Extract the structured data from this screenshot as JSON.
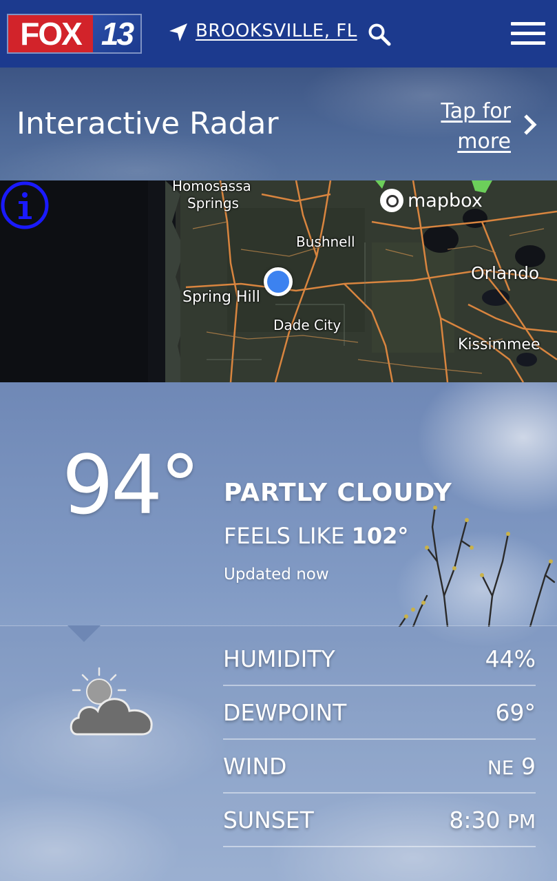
{
  "header": {
    "logo_left": "FOX",
    "logo_right": "13",
    "location": "BROOKSVILLE, FL"
  },
  "banner": {
    "title": "Interactive Radar",
    "link_line1": "Tap for",
    "link_line2": "more"
  },
  "map": {
    "attribution": "mapbox",
    "places": {
      "homosassa_line1": "Homosassa",
      "homosassa_line2": "Springs",
      "bushnell": "Bushnell",
      "orlando": "Orlando",
      "spring_hill": "Spring Hill",
      "dade_city": "Dade City",
      "kissimmee": "Kissimmee"
    }
  },
  "current": {
    "temperature": "94°",
    "condition": "PARTLY CLOUDY",
    "feels_like_label": "FEELS LIKE",
    "feels_like_value": "102°",
    "updated": "Updated now"
  },
  "details": [
    {
      "label": "HUMIDITY",
      "value": "44%",
      "prefix": "",
      "suffix": ""
    },
    {
      "label": "DEWPOINT",
      "value": "69°",
      "prefix": "",
      "suffix": ""
    },
    {
      "label": "WIND",
      "value": "9",
      "prefix": "NE",
      "suffix": ""
    },
    {
      "label": "SUNSET",
      "value": "8:30",
      "prefix": "",
      "suffix": "PM"
    }
  ],
  "colors": {
    "header_bg": "#1c3a8e",
    "logo_red": "#d2232a",
    "location_dot": "#3c82f0",
    "info_icon": "#1a1aff"
  },
  "icons": {
    "location": "location-arrow-icon",
    "search": "search-icon",
    "menu": "hamburger-menu-icon",
    "chevron": "chevron-right-icon",
    "info": "info-icon",
    "weather": "partly-cloudy-icon"
  }
}
